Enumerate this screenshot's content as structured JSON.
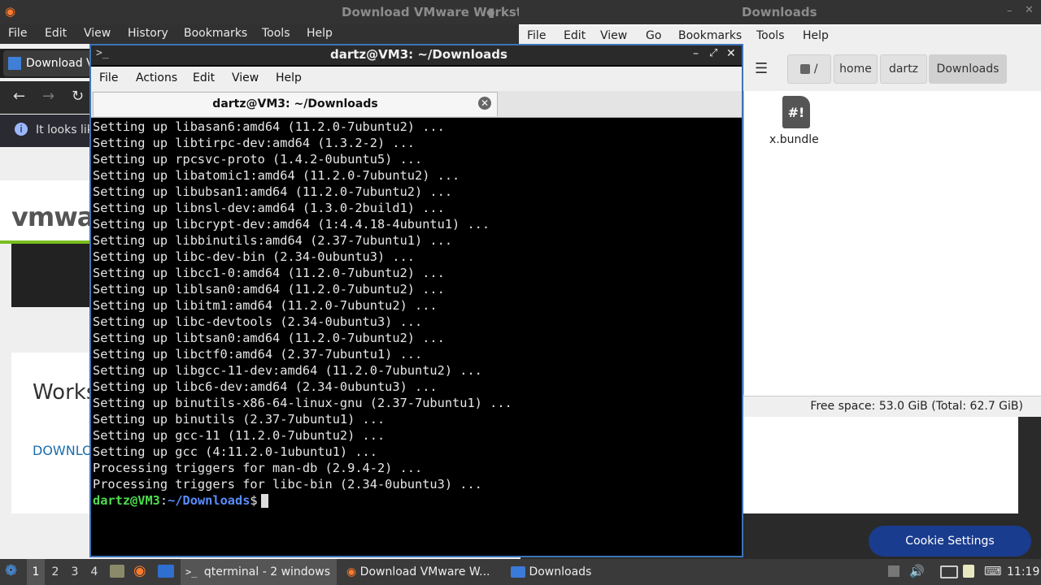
{
  "firefox": {
    "title": "Download VMware Workst",
    "menu": [
      "File",
      "Edit",
      "View",
      "History",
      "Bookmarks",
      "Tools",
      "Help"
    ],
    "tab_label": "Download Vi",
    "notice_text": "It looks lik",
    "logo_text": "vmwa",
    "heading_text": "Works",
    "download_text": "DOWNLO",
    "cookie_button": "Cookie Settings"
  },
  "file_manager": {
    "title": "Downloads",
    "menu": [
      "File",
      "Edit",
      "View",
      "Go",
      "Bookmarks",
      "Tools",
      "Help"
    ],
    "path": [
      "/",
      "home",
      "dartz",
      "Downloads"
    ],
    "files": [
      {
        "name": "x.bundle",
        "icon": "#!"
      }
    ],
    "status": "Free space: 53.0 GiB (Total: 62.7 GiB)"
  },
  "terminal": {
    "title": "dartz@VM3: ~/Downloads",
    "menu": [
      "File",
      "Actions",
      "Edit",
      "View",
      "Help"
    ],
    "tab_label": "dartz@VM3: ~/Downloads",
    "lines": [
      "Setting up libasan6:amd64 (11.2.0-7ubuntu2) ...",
      "Setting up libtirpc-dev:amd64 (1.3.2-2) ...",
      "Setting up rpcsvc-proto (1.4.2-0ubuntu5) ...",
      "Setting up libatomic1:amd64 (11.2.0-7ubuntu2) ...",
      "Setting up libubsan1:amd64 (11.2.0-7ubuntu2) ...",
      "Setting up libnsl-dev:amd64 (1.3.0-2build1) ...",
      "Setting up libcrypt-dev:amd64 (1:4.4.18-4ubuntu1) ...",
      "Setting up libbinutils:amd64 (2.37-7ubuntu1) ...",
      "Setting up libc-dev-bin (2.34-0ubuntu3) ...",
      "Setting up libcc1-0:amd64 (11.2.0-7ubuntu2) ...",
      "Setting up liblsan0:amd64 (11.2.0-7ubuntu2) ...",
      "Setting up libitm1:amd64 (11.2.0-7ubuntu2) ...",
      "Setting up libc-devtools (2.34-0ubuntu3) ...",
      "Setting up libtsan0:amd64 (11.2.0-7ubuntu2) ...",
      "Setting up libctf0:amd64 (2.37-7ubuntu1) ...",
      "Setting up libgcc-11-dev:amd64 (11.2.0-7ubuntu2) ...",
      "Setting up libc6-dev:amd64 (2.34-0ubuntu3) ...",
      "Setting up binutils-x86-64-linux-gnu (2.37-7ubuntu1) ...",
      "Setting up binutils (2.37-7ubuntu1) ...",
      "Setting up gcc-11 (11.2.0-7ubuntu2) ...",
      "Setting up gcc (4:11.2.0-1ubuntu1) ...",
      "Processing triggers for man-db (2.9.4-2) ...",
      "Processing triggers for libc-bin (2.34-0ubuntu3) ..."
    ],
    "prompt_user": "dartz@VM3",
    "prompt_sep": ":",
    "prompt_path": "~/Downloads",
    "prompt_end": "$"
  },
  "taskbar": {
    "workspaces": [
      "1",
      "2",
      "3",
      "4"
    ],
    "tasks": [
      "qterminal - 2 windows",
      "Download VMware W...",
      "Downloads"
    ],
    "clock": "11:19"
  }
}
